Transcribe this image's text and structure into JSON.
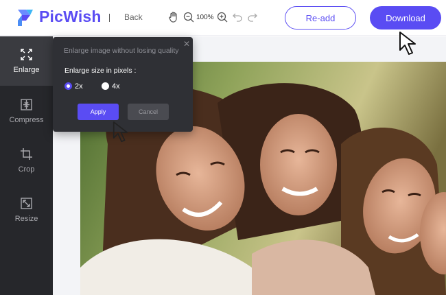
{
  "header": {
    "brand": "PicWish",
    "back_label": "Back",
    "zoom_level": "100%",
    "readd_label": "Re-add",
    "download_label": "Download"
  },
  "sidebar": {
    "items": [
      {
        "label": "Enlarge",
        "icon": "enlarge-icon",
        "active": true
      },
      {
        "label": "Compress",
        "icon": "compress-icon",
        "active": false
      },
      {
        "label": "Crop",
        "icon": "crop-icon",
        "active": false
      },
      {
        "label": "Resize",
        "icon": "resize-icon",
        "active": false
      }
    ]
  },
  "popup": {
    "hint": "Enlarge image without losing quality",
    "size_label": "Enlarge size in pixels :",
    "options": [
      {
        "label": "2x",
        "selected": true
      },
      {
        "label": "4x",
        "selected": false
      }
    ],
    "apply_label": "Apply",
    "cancel_label": "Cancel"
  },
  "colors": {
    "accent": "#5a4cf3",
    "sidebar_bg": "#26272b",
    "popup_bg": "#2f3035"
  }
}
